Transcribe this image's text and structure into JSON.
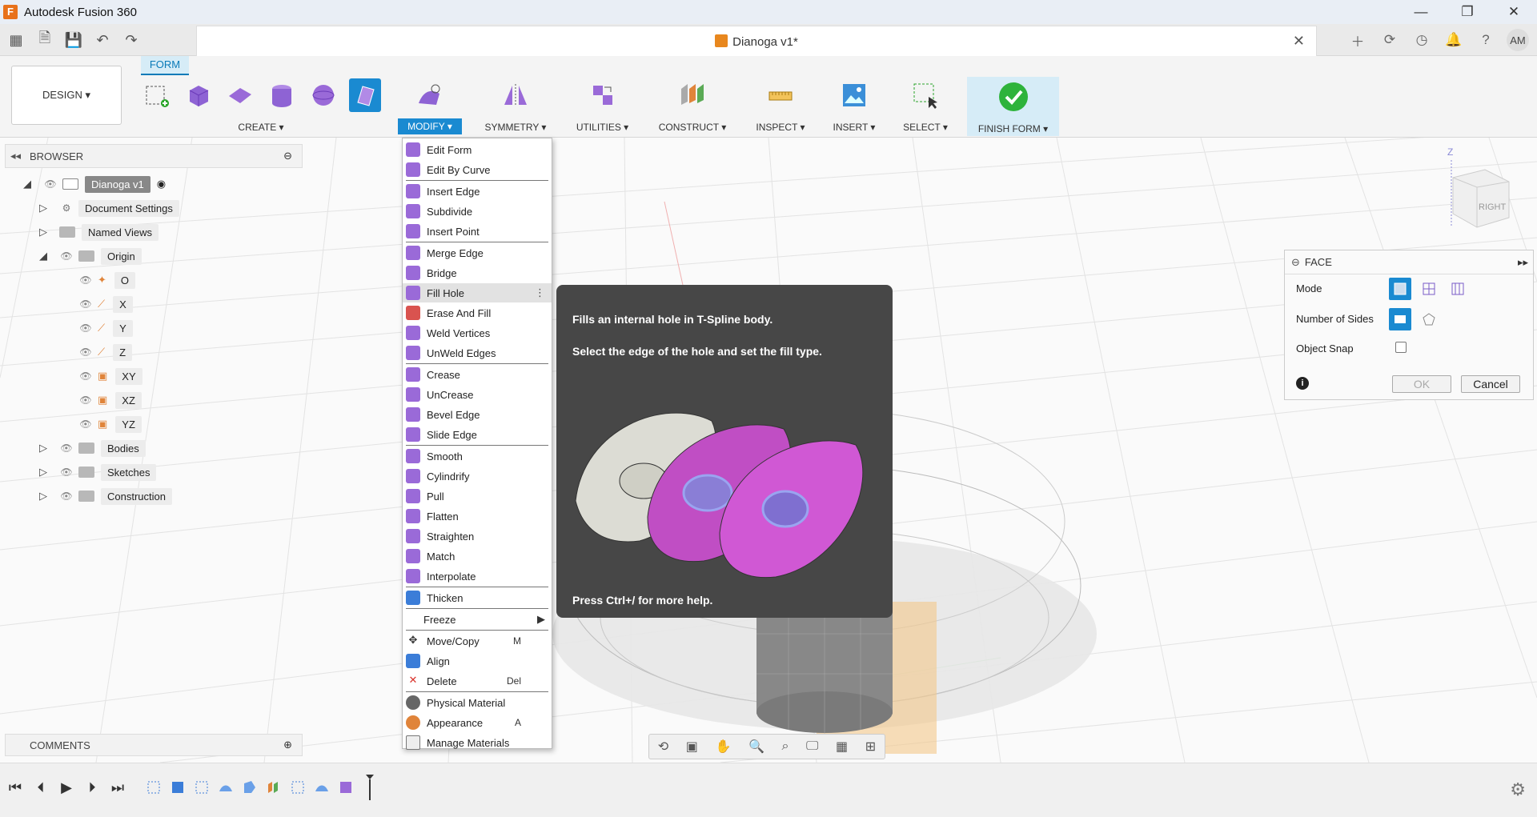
{
  "window": {
    "title": "Autodesk Fusion 360"
  },
  "document": {
    "title": "Dianoga v1*"
  },
  "user": {
    "initials": "AM"
  },
  "toolbar": {
    "workspace": "DESIGN ▾",
    "active_tab": "FORM",
    "groups": {
      "create": "CREATE ▾",
      "modify": "MODIFY ▾",
      "symmetry": "SYMMETRY ▾",
      "utilities": "UTILITIES ▾",
      "construct": "CONSTRUCT ▾",
      "inspect": "INSPECT ▾",
      "insert": "INSERT ▾",
      "select": "SELECT ▾",
      "finish": "FINISH FORM ▾"
    }
  },
  "browser": {
    "title": "BROWSER",
    "root": "Dianoga v1",
    "items": {
      "document_settings": "Document Settings",
      "named_views": "Named Views",
      "origin": "Origin",
      "o": "O",
      "x": "X",
      "y": "Y",
      "z": "Z",
      "xy": "XY",
      "xz": "XZ",
      "yz": "YZ",
      "bodies": "Bodies",
      "sketches": "Sketches",
      "construction": "Construction"
    }
  },
  "comments": {
    "title": "COMMENTS"
  },
  "modify_menu": {
    "items": [
      {
        "label": "Edit Form",
        "shortcut": "",
        "icon": "edit-form-icon"
      },
      {
        "label": "Edit By Curve",
        "shortcut": "",
        "icon": "edit-by-curve-icon"
      },
      {
        "label": "Insert Edge",
        "shortcut": "",
        "icon": "insert-edge-icon"
      },
      {
        "label": "Subdivide",
        "shortcut": "",
        "icon": "subdivide-icon"
      },
      {
        "label": "Insert Point",
        "shortcut": "",
        "icon": "insert-point-icon"
      },
      {
        "label": "Merge Edge",
        "shortcut": "",
        "icon": "merge-edge-icon"
      },
      {
        "label": "Bridge",
        "shortcut": "",
        "icon": "bridge-icon"
      },
      {
        "label": "Fill Hole",
        "shortcut": "",
        "icon": "fill-hole-icon"
      },
      {
        "label": "Erase And Fill",
        "shortcut": "",
        "icon": "erase-and-fill-icon"
      },
      {
        "label": "Weld Vertices",
        "shortcut": "",
        "icon": "weld-vertices-icon"
      },
      {
        "label": "UnWeld Edges",
        "shortcut": "",
        "icon": "unweld-edges-icon"
      },
      {
        "label": "Crease",
        "shortcut": "",
        "icon": "crease-icon"
      },
      {
        "label": "UnCrease",
        "shortcut": "",
        "icon": "uncrease-icon"
      },
      {
        "label": "Bevel Edge",
        "shortcut": "",
        "icon": "bevel-edge-icon"
      },
      {
        "label": "Slide Edge",
        "shortcut": "",
        "icon": "slide-edge-icon"
      },
      {
        "label": "Smooth",
        "shortcut": "",
        "icon": "smooth-icon"
      },
      {
        "label": "Cylindrify",
        "shortcut": "",
        "icon": "cylindrify-icon"
      },
      {
        "label": "Pull",
        "shortcut": "",
        "icon": "pull-icon"
      },
      {
        "label": "Flatten",
        "shortcut": "",
        "icon": "flatten-icon"
      },
      {
        "label": "Straighten",
        "shortcut": "",
        "icon": "straighten-icon"
      },
      {
        "label": "Match",
        "shortcut": "",
        "icon": "match-icon"
      },
      {
        "label": "Interpolate",
        "shortcut": "",
        "icon": "interpolate-icon"
      },
      {
        "label": "Thicken",
        "shortcut": "",
        "icon": "thicken-icon"
      },
      {
        "label": "Freeze",
        "shortcut": "",
        "icon": ""
      },
      {
        "label": "Move/Copy",
        "shortcut": "M",
        "icon": "move-copy-icon"
      },
      {
        "label": "Align",
        "shortcut": "",
        "icon": "align-icon"
      },
      {
        "label": "Delete",
        "shortcut": "Del",
        "icon": "delete-icon"
      },
      {
        "label": "Physical Material",
        "shortcut": "",
        "icon": "physical-material-icon"
      },
      {
        "label": "Appearance",
        "shortcut": "A",
        "icon": "appearance-icon"
      },
      {
        "label": "Manage Materials",
        "shortcut": "",
        "icon": "manage-materials-icon"
      }
    ]
  },
  "tooltip": {
    "line1": "Fills an internal hole in T-Spline body.",
    "line2": "Select the edge of the hole and set the fill type.",
    "footer": "Press Ctrl+/ for more help."
  },
  "face_panel": {
    "title": "FACE",
    "mode_label": "Mode",
    "sides_label": "Number of Sides",
    "snap_label": "Object Snap",
    "ok": "OK",
    "cancel": "Cancel"
  },
  "viewcube": {
    "face": "RIGHT",
    "axis_z": "Z"
  },
  "colors": {
    "accent": "#1a8ad1",
    "tspline_purple": "#9b5bc8",
    "menu_highlight": "#e2e2e2",
    "tooltip_bg": "#474747"
  }
}
